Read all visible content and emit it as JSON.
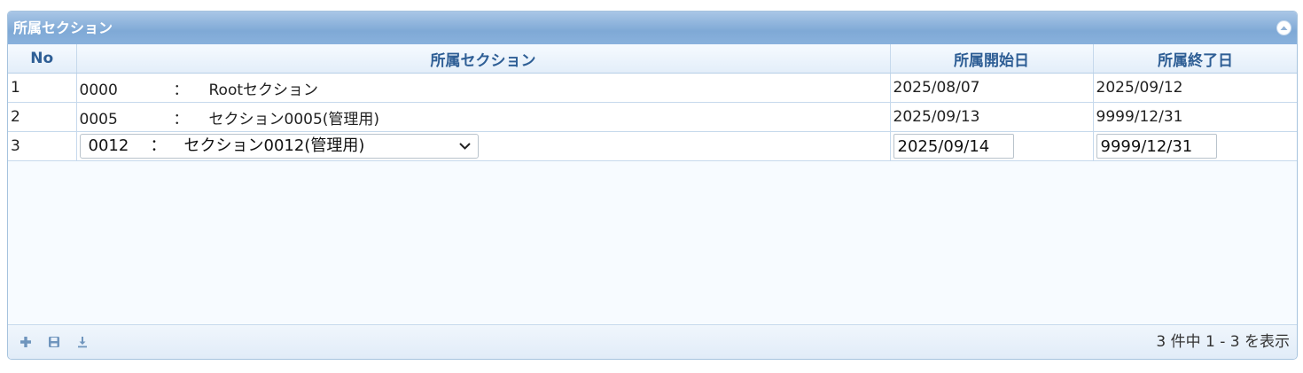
{
  "panel": {
    "title": "所属セクション",
    "collapse_icon": "collapse-up-icon"
  },
  "grid": {
    "columns": [
      "No",
      "所属セクション",
      "所属開始日",
      "所属終了日"
    ],
    "rows": [
      {
        "no": "1",
        "code": "0000",
        "sep": "：",
        "name": "Rootセクション",
        "start": "2025/08/07",
        "end": "2025/09/12"
      },
      {
        "no": "2",
        "code": "0005",
        "sep": "：",
        "name": "セクション0005(管理用)",
        "start": "2025/09/13",
        "end": "9999/12/31"
      }
    ],
    "edit_row": {
      "no": "3",
      "section_select": {
        "code": "0012",
        "sep": "：",
        "name": "セクション0012(管理用)"
      },
      "start_value": "2025/09/14",
      "end_value": "9999/12/31"
    }
  },
  "footer": {
    "icons": [
      "add-icon",
      "save-icon",
      "download-icon"
    ],
    "pager_text": "3 件中 1 - 3 を表示"
  },
  "colors": {
    "header_text": "#2e5e95",
    "title_bar": "#7fa9d6",
    "icon_blue": "#6f95bd"
  }
}
